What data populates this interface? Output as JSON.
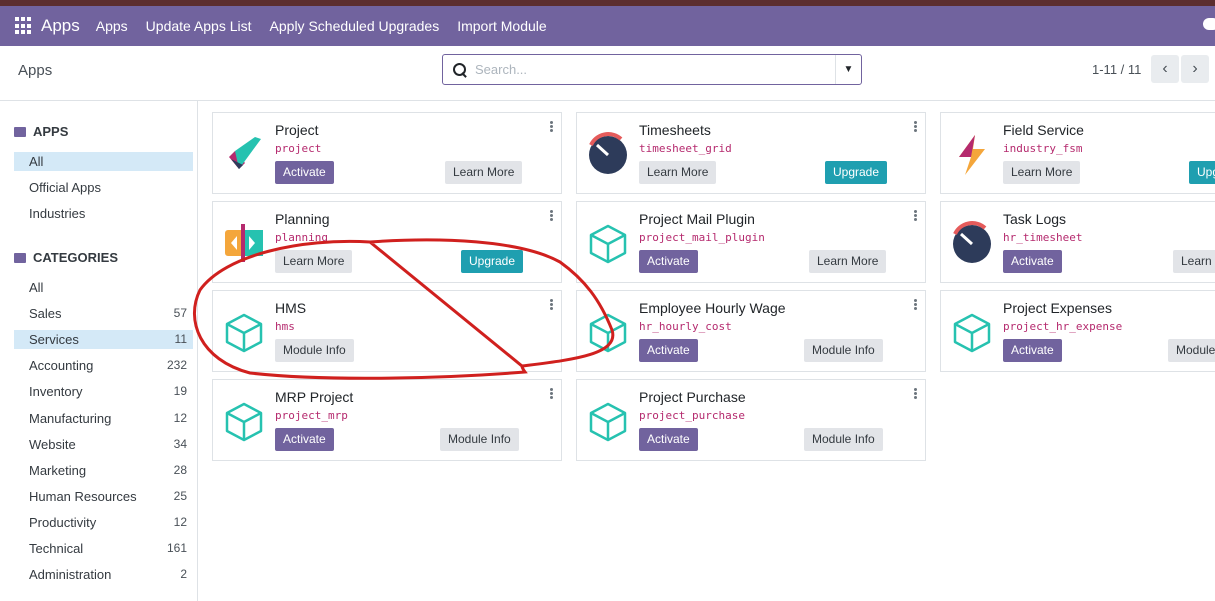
{
  "topbar": {
    "brand": "Apps",
    "menu": [
      "Apps",
      "Update Apps List",
      "Apply Scheduled Upgrades",
      "Import Module"
    ]
  },
  "control": {
    "breadcrumb": "Apps",
    "search_placeholder": "Search...",
    "pager": "1-11 / 11"
  },
  "sidebar": {
    "apps_heading": "APPS",
    "apps_items": [
      "All",
      "Official Apps",
      "Industries"
    ],
    "categories_heading": "CATEGORIES",
    "categories": [
      {
        "label": "All",
        "count": ""
      },
      {
        "label": "Sales",
        "count": "57"
      },
      {
        "label": "Services",
        "count": "11"
      },
      {
        "label": "Accounting",
        "count": "232"
      },
      {
        "label": "Inventory",
        "count": "19"
      },
      {
        "label": "Manufacturing",
        "count": "12"
      },
      {
        "label": "Website",
        "count": "34"
      },
      {
        "label": "Marketing",
        "count": "28"
      },
      {
        "label": "Human Resources",
        "count": "25"
      },
      {
        "label": "Productivity",
        "count": "12"
      },
      {
        "label": "Technical",
        "count": "161"
      },
      {
        "label": "Administration",
        "count": "2"
      }
    ]
  },
  "cards": [
    {
      "title": "Project",
      "tech": "project",
      "icon": "project-icon",
      "left_btn": "Activate",
      "right_btn": "Learn More"
    },
    {
      "title": "Timesheets",
      "tech": "timesheet_grid",
      "icon": "timesheets-icon",
      "left_btn": "Learn More",
      "right_btn": "Upgrade"
    },
    {
      "title": "Field Service",
      "tech": "industry_fsm",
      "icon": "field-service-icon",
      "left_btn": "Learn More",
      "right_btn": "Upgrade"
    },
    {
      "title": "Planning",
      "tech": "planning",
      "icon": "planning-icon",
      "left_btn": "Learn More",
      "right_btn": "Upgrade"
    },
    {
      "title": "Project Mail Plugin",
      "tech": "project_mail_plugin",
      "icon": "module-icon",
      "left_btn": "Activate",
      "right_btn": "Learn More"
    },
    {
      "title": "Task Logs",
      "tech": "hr_timesheet",
      "icon": "timesheets-icon",
      "left_btn": "Activate",
      "right_btn": "Learn More"
    },
    {
      "title": "HMS",
      "tech": "hms",
      "icon": "module-icon",
      "left_btn": "Module Info",
      "right_btn": ""
    },
    {
      "title": "Employee Hourly Wage",
      "tech": "hr_hourly_cost",
      "icon": "module-icon",
      "left_btn": "Activate",
      "right_btn": "Module Info"
    },
    {
      "title": "Project Expenses",
      "tech": "project_hr_expense",
      "icon": "module-icon",
      "left_btn": "Activate",
      "right_btn": "Module Info"
    },
    {
      "title": "MRP Project",
      "tech": "project_mrp",
      "icon": "module-icon",
      "left_btn": "Activate",
      "right_btn": "Module Info"
    },
    {
      "title": "Project Purchase",
      "tech": "project_purchase",
      "icon": "module-icon",
      "left_btn": "Activate",
      "right_btn": "Module Info"
    }
  ],
  "colors": {
    "brand": "#71639e",
    "upgrade": "#1f9fb0",
    "annotation": "#d0201e"
  }
}
